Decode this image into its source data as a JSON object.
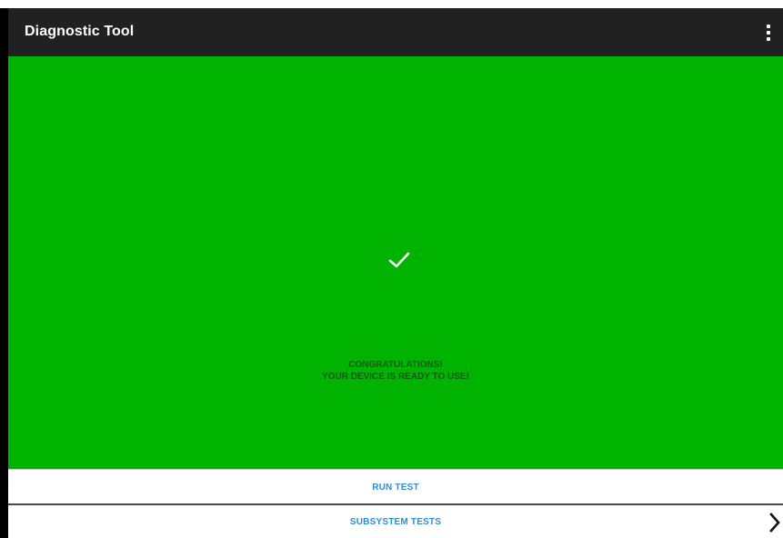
{
  "app_bar": {
    "title": "Diagnostic Tool",
    "menu_icon": "overflow-menu-icon"
  },
  "status": {
    "icon": "check-icon",
    "background_color": "#00b300",
    "line1": "CONGRATULATIONS!",
    "line2": "YOUR DEVICE IS READY TO USE!"
  },
  "actions": {
    "run_test_label": "RUN TEST",
    "subsystem_tests_label": "SUBSYSTEM TESTS",
    "subsystem_chevron_icon": "chevron-right-icon",
    "accent_color": "#2b8fd6"
  }
}
